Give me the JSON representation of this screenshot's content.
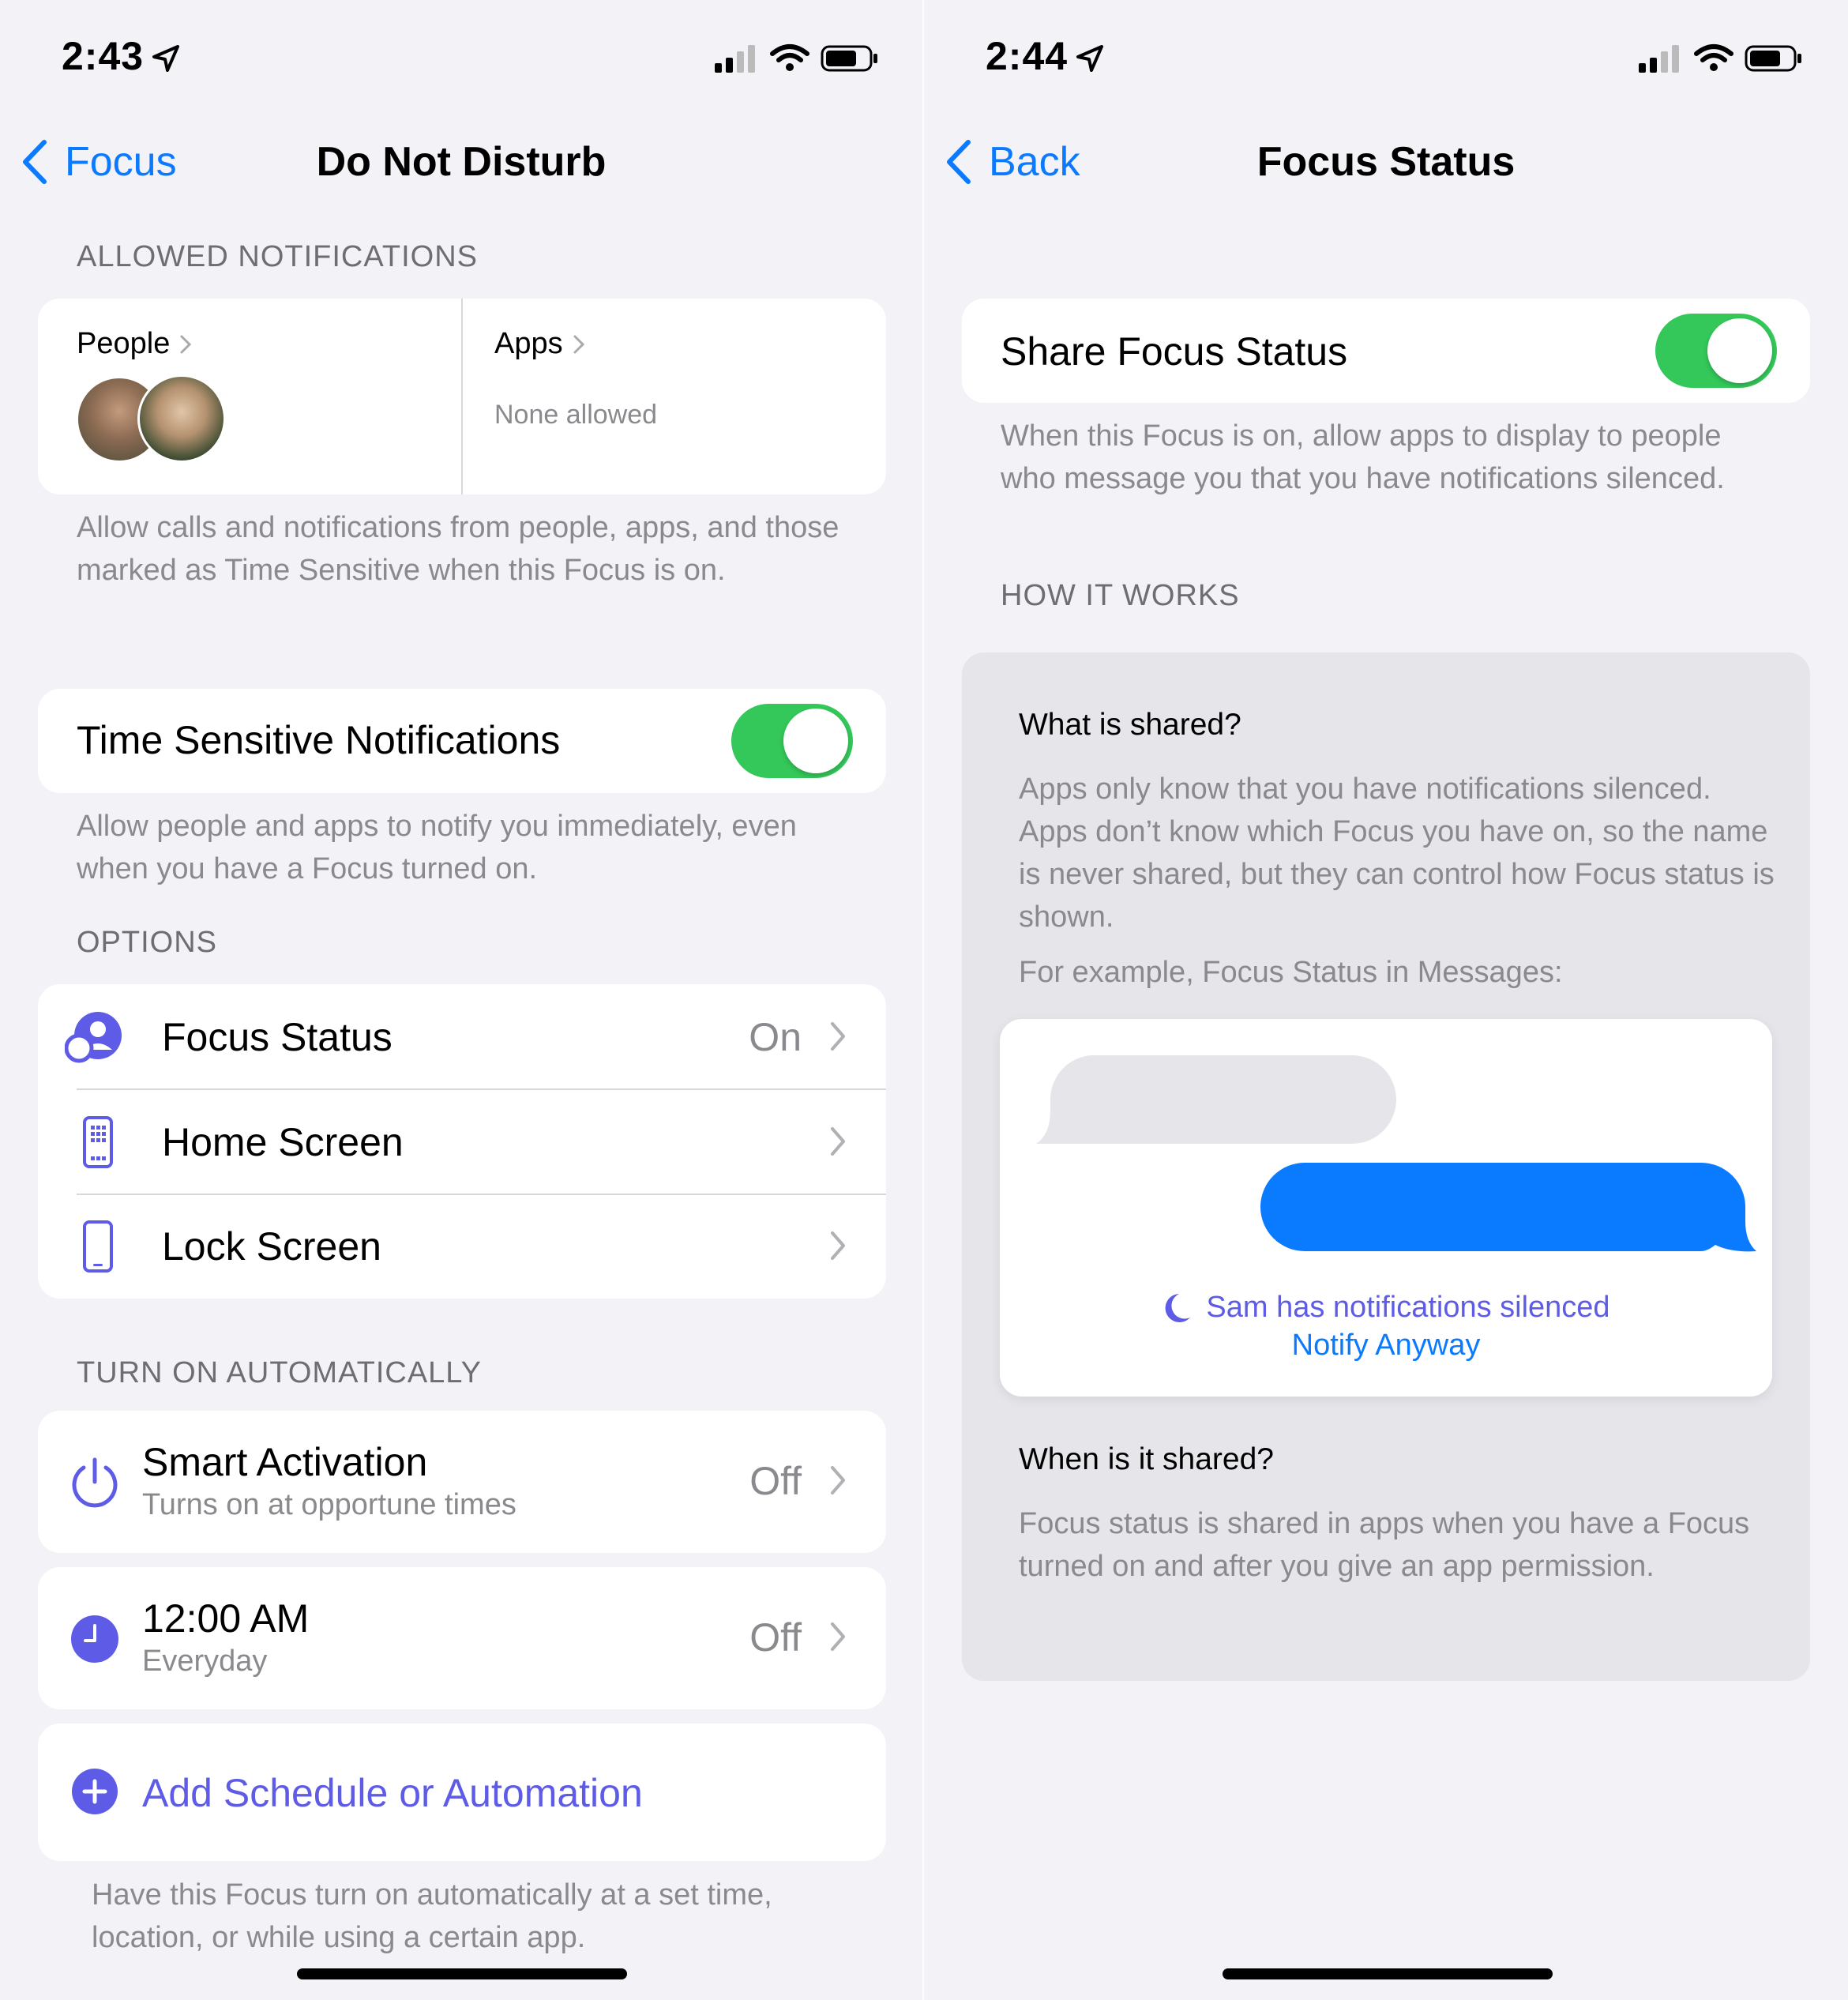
{
  "left": {
    "status_time": "2:43",
    "back_label": "Focus",
    "title": "Do Not Disturb",
    "allowed_header": "ALLOWED NOTIFICATIONS",
    "people_label": "People",
    "apps_label": "Apps",
    "apps_value": "None allowed",
    "allowed_footer": "Allow calls and notifications from people, apps, and those marked as Time Sensitive when this Focus is on.",
    "time_sensitive_label": "Time Sensitive Notifications",
    "time_sensitive_on": true,
    "time_sensitive_footer": "Allow people and apps to notify you immediately, even when you have a Focus turned on.",
    "options_header": "OPTIONS",
    "options": [
      {
        "label": "Focus Status",
        "value": "On",
        "icon": "focus-status-icon"
      },
      {
        "label": "Home Screen",
        "value": "",
        "icon": "home-screen-icon"
      },
      {
        "label": "Lock Screen",
        "value": "",
        "icon": "lock-screen-icon"
      }
    ],
    "auto_header": "TURN ON AUTOMATICALLY",
    "smart_title": "Smart Activation",
    "smart_sub": "Turns on at opportune times",
    "smart_value": "Off",
    "schedule_title": "12:00 AM",
    "schedule_sub": "Everyday",
    "schedule_value": "Off",
    "add_label": "Add Schedule or Automation",
    "auto_footer": "Have this Focus turn on automatically at a set time, location, or while using a certain app."
  },
  "right": {
    "status_time": "2:44",
    "back_label": "Back",
    "title": "Focus Status",
    "share_label": "Share Focus Status",
    "share_on": true,
    "share_footer": "When this Focus is on, allow apps to display to people who message you that you have notifications silenced.",
    "how_header": "HOW IT WORKS",
    "what_title": "What is shared?",
    "what_body": "Apps only know that you have notifications silenced. Apps don’t know which Focus you have on, so the name is never shared, but they can control how Focus status is shown.",
    "example_label": "For example, Focus Status in Messages:",
    "silenced_text": "Sam has notifications silenced",
    "notify_anyway": "Notify Anyway",
    "when_title": "When is it shared?",
    "when_body": "Focus status is shared in apps when you have a Focus turned on and after you give an app permission."
  },
  "colors": {
    "accent_blue": "#0a7aff",
    "toggle_green": "#34c759",
    "focus_purple": "#5e5ce6",
    "message_blue": "#0a7aff"
  }
}
